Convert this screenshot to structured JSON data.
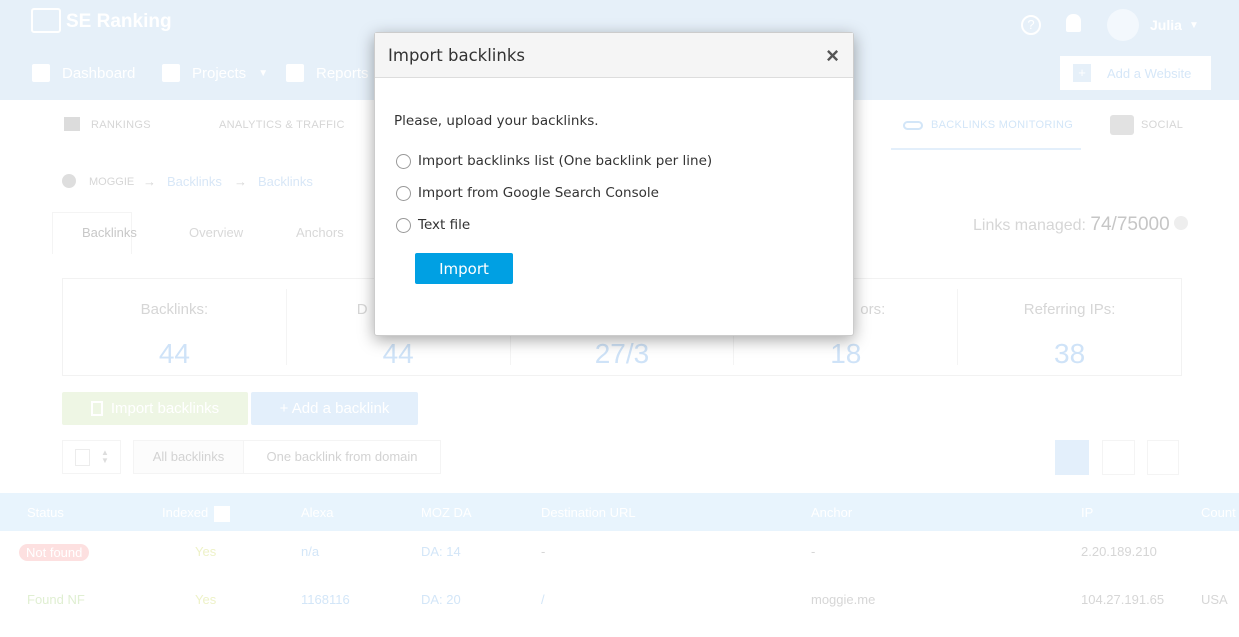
{
  "header": {
    "logo": "SE Ranking",
    "nav": [
      "Dashboard",
      "Projects",
      "Reports"
    ],
    "user": "Julia",
    "add_website": "Add a Website"
  },
  "tabs": {
    "rankings": "RANKINGS",
    "analytics": "ANALYTICS & TRAFFIC",
    "backlinks": "BACKLINKS MONITORING",
    "social": "SOCIAL"
  },
  "breadcrumb": [
    "MOGGIE",
    "Backlinks",
    "Backlinks"
  ],
  "subtabs": [
    "Backlinks",
    "Overview",
    "Anchors"
  ],
  "links_managed": {
    "label": "Links managed:",
    "value": "74/75000"
  },
  "stats": [
    {
      "label": "Backlinks:",
      "value": "44"
    },
    {
      "label": "D",
      "value": "44"
    },
    {
      "label": "",
      "value": "27/3"
    },
    {
      "label": "ors:",
      "value": "18"
    },
    {
      "label": "Referring IPs:",
      "value": "38"
    }
  ],
  "actions": {
    "import": "Import backlinks",
    "add": "+ Add a backlink"
  },
  "filters": [
    "All backlinks",
    "One backlink from domain"
  ],
  "table": {
    "columns": [
      "Status",
      "Indexed",
      "Alexa",
      "MOZ DA",
      "Destination URL",
      "Anchor",
      "IP",
      "Count"
    ],
    "rows": [
      [
        "Not found",
        "Yes",
        "n/a",
        "DA: 14",
        "-",
        "-",
        "2.20.189.210",
        ""
      ],
      [
        "Found NF",
        "Yes",
        "1168116",
        "DA: 20",
        "/",
        "moggie.me",
        "104.27.191.65",
        "USA"
      ]
    ]
  },
  "modal": {
    "title": "Import backlinks",
    "close": "×",
    "prompt": "Please, upload your backlinks.",
    "options": [
      "Import backlinks list (One backlink per line)",
      "Import from Google Search Console",
      "Text file"
    ],
    "submit": "Import"
  },
  "colors": {
    "header": "#3f8fd8",
    "primary": "#00a0e3",
    "import_green": "#8bc34a"
  }
}
